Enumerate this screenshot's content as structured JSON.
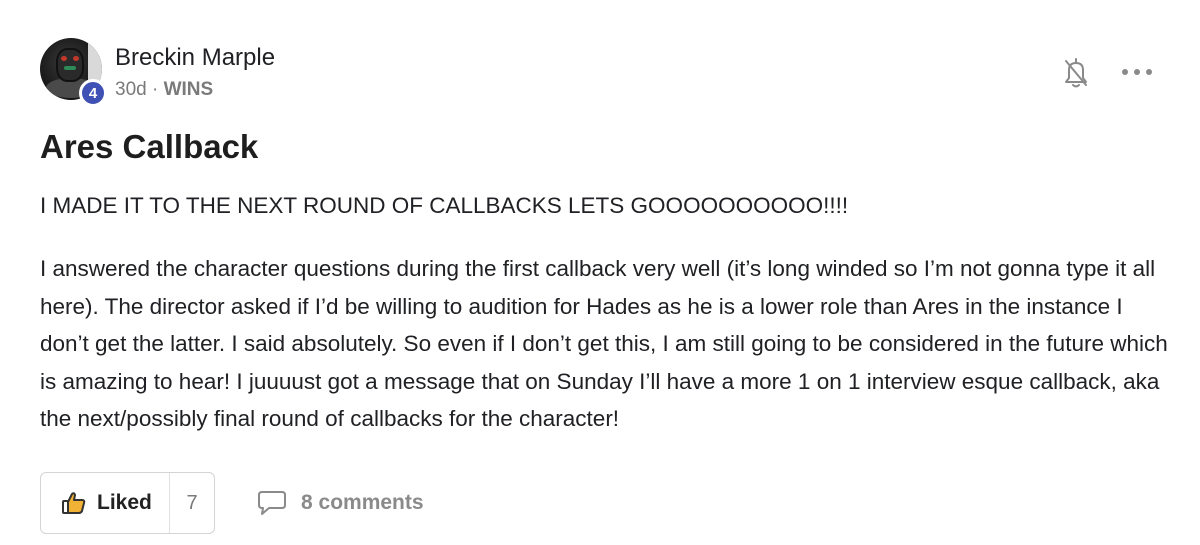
{
  "post": {
    "author": "Breckin Marple",
    "level": "4",
    "age": "30d",
    "separator": "·",
    "category": "WINS",
    "title": "Ares Callback",
    "lead": "I MADE IT TO THE NEXT ROUND OF CALLBACKS LETS GOOOOOOOOOO!!!!",
    "body": "I answered the character questions during the first callback very well (it’s long winded so I’m not gonna type it all here). The director asked if I’d be willing to audition for Hades as he is a lower role than Ares in the instance I don’t get the latter. I said absolutely. So even if I don’t get this, I am still going to be considered in the future which is amazing to hear! I juuuust got a message that on Sunday I’ll have a more 1 on 1 interview esque callback, aka the next/possibly final round of callbacks for the character!"
  },
  "actions": {
    "like_label": "Liked",
    "like_count": "7",
    "comments_label": "8 comments"
  },
  "icons": {
    "bell": "bell-off-icon",
    "more": "more-horizontal-icon",
    "like": "thumbs-up-icon",
    "comment": "comment-icon"
  },
  "colors": {
    "level_badge": "#3f51b5",
    "text": "#202124",
    "muted": "#7a7a7a"
  }
}
